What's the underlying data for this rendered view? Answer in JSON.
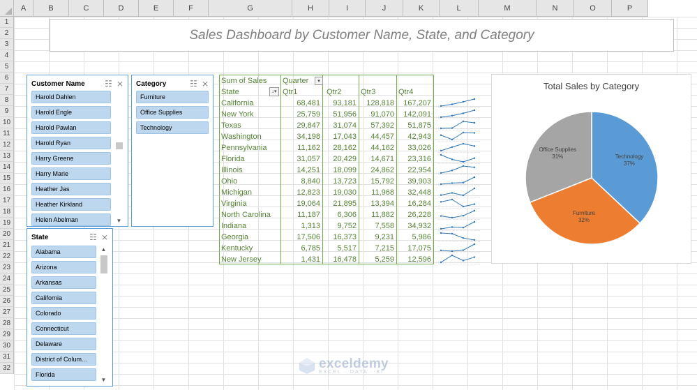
{
  "columns": [
    "A",
    "B",
    "C",
    "D",
    "E",
    "F",
    "G",
    "H",
    "I",
    "J",
    "K",
    "L",
    "M",
    "N",
    "O",
    "P"
  ],
  "rows": [
    "1",
    "2",
    "3",
    "4",
    "5",
    "6",
    "7",
    "8",
    "9",
    "10",
    "11",
    "12",
    "13",
    "14",
    "15",
    "16",
    "17",
    "18",
    "19",
    "20",
    "21",
    "22",
    "23",
    "24",
    "25",
    "26",
    "27",
    "28",
    "29",
    "30",
    "31",
    "32"
  ],
  "dashboard_title": "Sales Dashboard by Customer Name, State, and Category",
  "slicer_customer": {
    "title": "Customer Name",
    "items": [
      "Harold Dahlen",
      "Harold Engle",
      "Harold Pawlan",
      "Harold Ryan",
      "Harry Greene",
      "Harry Marie",
      "Heather Jas",
      "Heather Kirkland",
      "Helen Abelman"
    ]
  },
  "slicer_category": {
    "title": "Category",
    "items": [
      "Furniture",
      "Office Supplies",
      "Technology"
    ]
  },
  "slicer_state": {
    "title": "State",
    "items": [
      "Alabama",
      "Arizona",
      "Arkansas",
      "California",
      "Colorado",
      "Connecticut",
      "Delaware",
      "District of Colum...",
      "Florida"
    ]
  },
  "pivot": {
    "header_row1": [
      "Sum of Sales",
      "Quarter"
    ],
    "header_row2": [
      "State",
      "Qtr1",
      "Qtr2",
      "Qtr3",
      "Qtr4"
    ],
    "rows": [
      {
        "state": "California",
        "q": [
          "68,481",
          "93,181",
          "128,818",
          "167,207"
        ],
        "v": [
          68481,
          93181,
          128818,
          167207
        ]
      },
      {
        "state": "New York",
        "q": [
          "25,759",
          "51,956",
          "91,070",
          "142,091"
        ],
        "v": [
          25759,
          51956,
          91070,
          142091
        ]
      },
      {
        "state": "Texas",
        "q": [
          "29,847",
          "31,074",
          "57,392",
          "51,875"
        ],
        "v": [
          29847,
          31074,
          57392,
          51875
        ]
      },
      {
        "state": "Washington",
        "q": [
          "34,198",
          "17,043",
          "44,457",
          "42,943"
        ],
        "v": [
          34198,
          17043,
          44457,
          42943
        ]
      },
      {
        "state": "Pennsylvania",
        "q": [
          "11,162",
          "28,162",
          "44,162",
          "33,026"
        ],
        "v": [
          11162,
          28162,
          44162,
          33026
        ]
      },
      {
        "state": "Florida",
        "q": [
          "31,057",
          "20,429",
          "14,671",
          "23,316"
        ],
        "v": [
          31057,
          20429,
          14671,
          23316
        ]
      },
      {
        "state": "Illinois",
        "q": [
          "14,251",
          "18,099",
          "24,862",
          "22,954"
        ],
        "v": [
          14251,
          18099,
          24862,
          22954
        ]
      },
      {
        "state": "Ohio",
        "q": [
          "8,840",
          "13,723",
          "15,792",
          "39,903"
        ],
        "v": [
          8840,
          13723,
          15792,
          39903
        ]
      },
      {
        "state": "Michigan",
        "q": [
          "12,823",
          "19,030",
          "11,968",
          "32,448"
        ],
        "v": [
          12823,
          19030,
          11968,
          32448
        ]
      },
      {
        "state": "Virginia",
        "q": [
          "19,064",
          "21,895",
          "13,394",
          "16,284"
        ],
        "v": [
          19064,
          21895,
          13394,
          16284
        ]
      },
      {
        "state": "North Carolina",
        "q": [
          "11,187",
          "6,306",
          "11,882",
          "26,228"
        ],
        "v": [
          11187,
          6306,
          11882,
          26228
        ]
      },
      {
        "state": "Indiana",
        "q": [
          "1,313",
          "9,752",
          "7,558",
          "34,932"
        ],
        "v": [
          1313,
          9752,
          7558,
          34932
        ]
      },
      {
        "state": "Georgia",
        "q": [
          "17,506",
          "16,373",
          "9,231",
          "5,986"
        ],
        "v": [
          17506,
          16373,
          9231,
          5986
        ]
      },
      {
        "state": "Kentucky",
        "q": [
          "6,785",
          "5,517",
          "7,215",
          "17,075"
        ],
        "v": [
          6785,
          5517,
          7215,
          17075
        ]
      },
      {
        "state": "New Jersey",
        "q": [
          "1,431",
          "16,478",
          "5,259",
          "12,596"
        ],
        "v": [
          1431,
          16478,
          5259,
          12596
        ]
      }
    ]
  },
  "chart_data": {
    "type": "pie",
    "title": "Total Sales by Category",
    "categories": [
      "Technology",
      "Furniture",
      "Office Supplies"
    ],
    "values": [
      37,
      32,
      31
    ],
    "labels": [
      "37%",
      "32%",
      "31%"
    ],
    "colors": [
      "#5b9bd5",
      "#ed7d31",
      "#a5a5a5"
    ]
  },
  "watermark": {
    "name": "exceldemy",
    "sub": "EXCEL · DATA · BI"
  },
  "colors": {
    "slicer_item": "#bdd7ee",
    "pivot_green": "#70ad47",
    "spark": "#2e75b6"
  }
}
